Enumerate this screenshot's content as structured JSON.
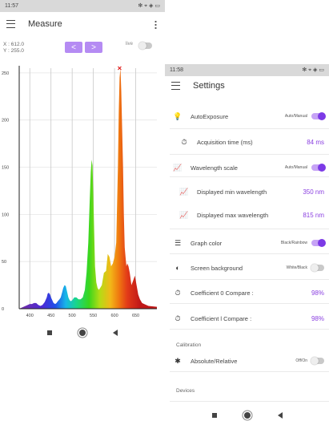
{
  "measure_screen": {
    "status_time": "11:57",
    "status_right": "✻ ⌖ ◈ ▭",
    "title": "Measure",
    "x_readout": "X : 612.0",
    "y_readout": "Y : 255.0",
    "prev_label": "<",
    "next_label": ">",
    "live_label": "live",
    "live_on": false
  },
  "chart_data": {
    "type": "area",
    "title": "",
    "xlabel": "",
    "ylabel": "",
    "xlim": [
      375,
      700
    ],
    "ylim": [
      0,
      255
    ],
    "xticks": [
      400,
      450,
      500,
      550,
      600,
      650
    ],
    "xtick_labels": [
      "400",
      "450",
      "500",
      "550",
      "600",
      "650"
    ],
    "yticks": [
      0,
      50,
      100,
      150,
      200,
      250
    ],
    "ytick_labels": [
      "0",
      "50",
      "100",
      "150",
      "200",
      "250"
    ],
    "grid": true,
    "series": [
      {
        "x": [
          375,
          390,
          400,
          405,
          410,
          415,
          420,
          425,
          430,
          435,
          440,
          442,
          445,
          448,
          450,
          453,
          456,
          460,
          463,
          466,
          470,
          473,
          476,
          479,
          482,
          485,
          488,
          491,
          494,
          497,
          500,
          505,
          510,
          515,
          520,
          525,
          530,
          534,
          538,
          541,
          544,
          546,
          548,
          550,
          552,
          554,
          557,
          560,
          563,
          566,
          570,
          575,
          580,
          584,
          588,
          592,
          596,
          600,
          604,
          608,
          610,
          612,
          614,
          616,
          618,
          620,
          622,
          624,
          626,
          628,
          630,
          633,
          636,
          640,
          644,
          648,
          652,
          656,
          660,
          665,
          670,
          680,
          700
        ],
        "y": [
          0,
          3,
          5,
          5,
          6,
          6,
          4,
          3,
          4,
          7,
          12,
          16,
          17,
          15,
          12,
          9,
          6,
          5,
          6,
          8,
          10,
          12,
          17,
          22,
          25,
          24,
          18,
          12,
          9,
          8,
          9,
          12,
          12,
          10,
          10,
          12,
          20,
          38,
          70,
          110,
          145,
          158,
          152,
          120,
          80,
          45,
          28,
          22,
          20,
          22,
          25,
          38,
          40,
          58,
          55,
          45,
          48,
          55,
          70,
          150,
          210,
          245,
          255,
          230,
          190,
          150,
          100,
          65,
          55,
          45,
          48,
          45,
          38,
          25,
          30,
          35,
          25,
          15,
          10,
          6,
          5,
          3,
          2
        ]
      }
    ],
    "marker": {
      "x": 612,
      "y": 255
    }
  },
  "settings_screen": {
    "status_time": "11:58",
    "status_right": "✻ ⌖ ◈ ▭",
    "title": "Settings",
    "rows": [
      {
        "icon": "💡",
        "label": "AutoExposure",
        "small": "Auto/Manual",
        "toggle": true
      },
      {
        "icon": "⏱",
        "label": "Acquisition time (ms)",
        "value": "84 ms"
      },
      {
        "icon": "📈",
        "label": "Wavelength scale",
        "small": "Auto/Manual",
        "toggle": true
      },
      {
        "icon": "📈",
        "label": "Displayed min wavelength",
        "value": "350 nm"
      },
      {
        "icon": "📈",
        "label": "Displayed max wavelength",
        "value": "815 nm"
      },
      {
        "icon": "☰",
        "label": "Graph color",
        "small": "Black/Rainbow",
        "toggle": true
      },
      {
        "icon": "◐",
        "label": "Screen background",
        "small": "White/Black",
        "toggle": false
      },
      {
        "icon": "⏱",
        "label": "Coefficient 0 Compare :",
        "value": "98%"
      },
      {
        "icon": "⏱",
        "label": "Coefficient l Compare :",
        "value": "98%"
      }
    ],
    "calibration_header": "Calibration",
    "abs_rel": {
      "icon": "✱",
      "label": "Absolute/Relative",
      "small": "Off/On",
      "toggle": false
    },
    "devices_header": "Devices"
  }
}
